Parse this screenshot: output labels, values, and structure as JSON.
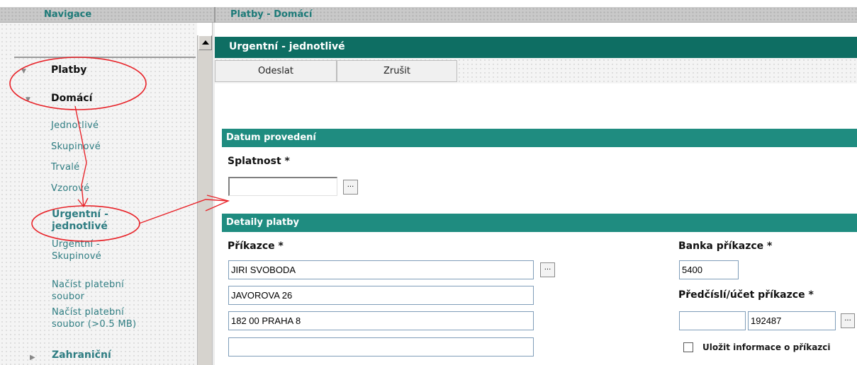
{
  "header": {
    "nav_title": "Navigace",
    "page_title": "Platby - Domácí"
  },
  "sidebar": {
    "sections": [
      {
        "label": "Platby"
      },
      {
        "label": "Domácí"
      }
    ],
    "items": [
      {
        "label": "Jednotlivé"
      },
      {
        "label": "Skupinové"
      },
      {
        "label": "Trvalé"
      },
      {
        "label": "Vzorové"
      },
      {
        "label_1": "Urgentní -",
        "label_2": "jednotlivé"
      },
      {
        "label_1": "Urgentní -",
        "label_2": "Skupinové"
      },
      {
        "label_1": "Načíst platební",
        "label_2": "soubor"
      },
      {
        "label_1": "Načíst platební",
        "label_2": "soubor (>0.5 MB)"
      }
    ],
    "more_section": "Zahraniční"
  },
  "main": {
    "title": "Urgentní - jednotlivé",
    "toolbar": {
      "send": "Odeslat",
      "cancel": "Zrušit"
    },
    "section_date": {
      "title": "Datum provedení",
      "due_label": "Splatnost *",
      "due_value": ""
    },
    "section_details": {
      "title": "Detaily platby",
      "payer_label": "Příkazce *",
      "payer_lines": [
        "JIRI SVOBODA",
        "JAVOROVA 26",
        "182 00 PRAHA 8",
        ""
      ],
      "bank_label": "Banka příkazce *",
      "bank_value": "5400",
      "account_label": "Předčíslí/účet příkazce *",
      "account_prefix": "",
      "account_number": "192487",
      "save_info_label": "Uložit informace o příkazci",
      "save_info_checked": false
    },
    "picker_glyph": "..."
  },
  "colors": {
    "title_bar": "#0e6e63",
    "section_bar": "#1f8c80",
    "link": "#2e7d82",
    "annotation": "#e8242a"
  }
}
